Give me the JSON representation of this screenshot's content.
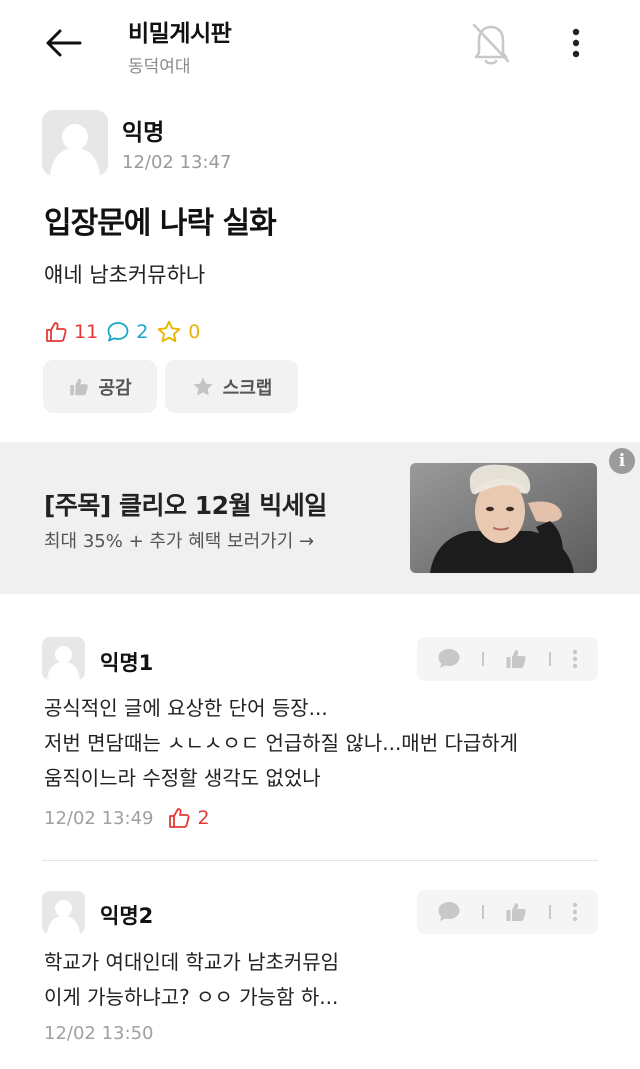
{
  "header": {
    "title": "비밀게시판",
    "subtitle": "동덕여대",
    "back_icon": "arrow-left-icon",
    "bell_icon": "bell-off-icon",
    "more_icon": "more-vertical-icon"
  },
  "post": {
    "author": "익명",
    "time": "12/02 13:47",
    "title": "입장문에 나락 실화",
    "body": "얘네 남초커뮤하나",
    "stats": {
      "likes": "11",
      "comments": "2",
      "scraps": "0"
    },
    "actions": {
      "like_label": "공감",
      "scrap_label": "스크랩"
    }
  },
  "ad": {
    "title": "[주목] 클리오 12월 빅세일",
    "subtitle": "최대 35% + 추가 혜택 보러가기 →",
    "info_label": "i"
  },
  "comments": [
    {
      "author": "익명1",
      "lines": [
        "공식적인 글에 요상한 단어 등장...",
        "저번 면담때는 ㅅㄴㅅㅇㄷ 언급하질 않나...매번 다급하게",
        "움직이느라 수정할 생각도 없었나"
      ],
      "time": "12/02 13:49",
      "likes": "2"
    },
    {
      "author": "익명2",
      "lines": [
        "학교가 여대인데 학교가 남초커뮤임",
        "이게 가능하냐고? ㅇㅇ 가능함 하..."
      ],
      "time": "12/02 13:50"
    }
  ],
  "colors": {
    "like": "#e53935",
    "comment": "#18a6c9",
    "scrap": "#e8b600"
  }
}
